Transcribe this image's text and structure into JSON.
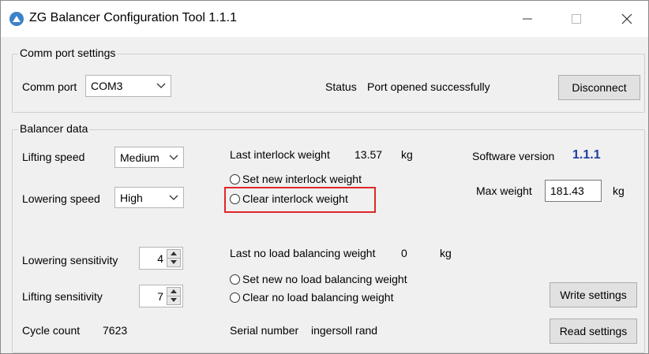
{
  "window": {
    "title": "ZG Balancer Configuration Tool 1.1.1",
    "icon": "app-icon",
    "controls": {
      "minimize": "minimize-icon",
      "maximize": "maximize-icon",
      "close": "close-icon"
    }
  },
  "comm": {
    "group_label": "Comm port settings",
    "port_label": "Comm port",
    "port_value": "COM3",
    "status_label": "Status",
    "status_value": "Port opened successfully",
    "disconnect_label": "Disconnect"
  },
  "balancer": {
    "group_label": "Balancer data",
    "lifting_speed_label": "Lifting speed",
    "lifting_speed_value": "Medium",
    "lowering_speed_label": "Lowering speed",
    "lowering_speed_value": "High",
    "lowering_sensitivity_label": "Lowering sensitivity",
    "lowering_sensitivity_value": "4",
    "lifting_sensitivity_label": "Lifting sensitivity",
    "lifting_sensitivity_value": "7",
    "cycle_count_label": "Cycle count",
    "cycle_count_value": "7623",
    "last_interlock_label": "Last interlock weight",
    "last_interlock_value": "13.57",
    "last_interlock_unit": "kg",
    "set_interlock_label": "Set new interlock weight",
    "clear_interlock_label": "Clear interlock weight",
    "software_version_label": "Software version",
    "software_version_value": "1.1.1",
    "max_weight_label": "Max weight",
    "max_weight_value": "181.43",
    "max_weight_unit": "kg",
    "last_noload_label": "Last no load balancing weight",
    "last_noload_value": "0",
    "last_noload_unit": "kg",
    "set_noload_label": "Set new no load balancing weight",
    "clear_noload_label": "Clear no load balancing weight",
    "serial_label": "Serial number",
    "serial_value": "ingersoll rand",
    "write_settings_label": "Write settings",
    "read_settings_label": "Read settings"
  },
  "colors": {
    "highlight": "#e0262b",
    "version_text": "#1f3fa0",
    "window_bg": "#f0f0f0"
  }
}
